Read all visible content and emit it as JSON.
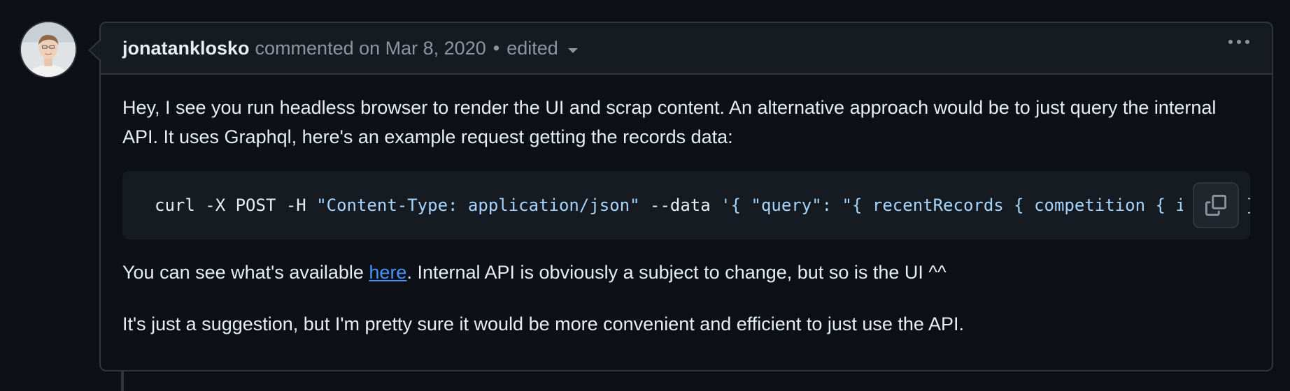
{
  "comment": {
    "author": "jonatanklosko",
    "commented_on": "commented on Mar 8, 2020",
    "separator": "•",
    "edited_label": "edited",
    "paragraphs": {
      "p1": "Hey, I see you run headless browser to render the UI and scrap content. An alternative approach would be to just query the internal API. It uses Graphql, here's an example request getting the records data:",
      "p2_before": "You can see what's available ",
      "p2_link": "here",
      "p2_after": ". Internal API is obviously a subject to change, but so is the UI ^^",
      "p3": "It's just a suggestion, but I'm pretty sure it would be more convenient and efficient to just use the API."
    },
    "code": {
      "part1": "curl -X POST -H ",
      "part2": "\"Content-Type: application/json\"",
      "part3": " --data ",
      "part4": "'{ \"query\": \"{ recentRecords { competition { id } } } }\" }'"
    }
  },
  "icons": {
    "avatar": "user-avatar",
    "dropdown": "chevron-down-icon",
    "more": "kebab-horizontal-icon",
    "copy": "copy-icon"
  },
  "colors": {
    "background": "#0d1117",
    "header_bg": "#161b22",
    "border": "#30363d",
    "text": "#e6edf3",
    "muted": "#8d96a0",
    "link": "#4493f8",
    "code_string": "#a5d6ff"
  }
}
